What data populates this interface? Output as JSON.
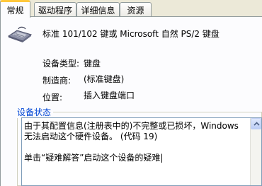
{
  "tabs": [
    {
      "label": "常规"
    },
    {
      "label": "驱动程序"
    },
    {
      "label": "详细信息"
    },
    {
      "label": "资源"
    }
  ],
  "device": {
    "icon": "keyboard-icon",
    "name": "标准 101/102 键或 Microsoft 自然 PS/2 键盘"
  },
  "properties": {
    "type_label": "设备类型:",
    "type_value": "键盘",
    "manufacturer_label": "制造商:",
    "manufacturer_value": "(标准键盘)",
    "location_label": "位置:",
    "location_value": "插入键盘端口"
  },
  "status": {
    "group_title": "设备状态",
    "text": "由于其配置信息(注册表中的)不完整或已损坏，Windows 无法启动这个硬件设备。 (代码 19)\n\n单击“疑难解答”启动这个设备的疑难|"
  },
  "colors": {
    "active_tab_accent": "#ffc83c",
    "group_title": "#0046d5"
  }
}
